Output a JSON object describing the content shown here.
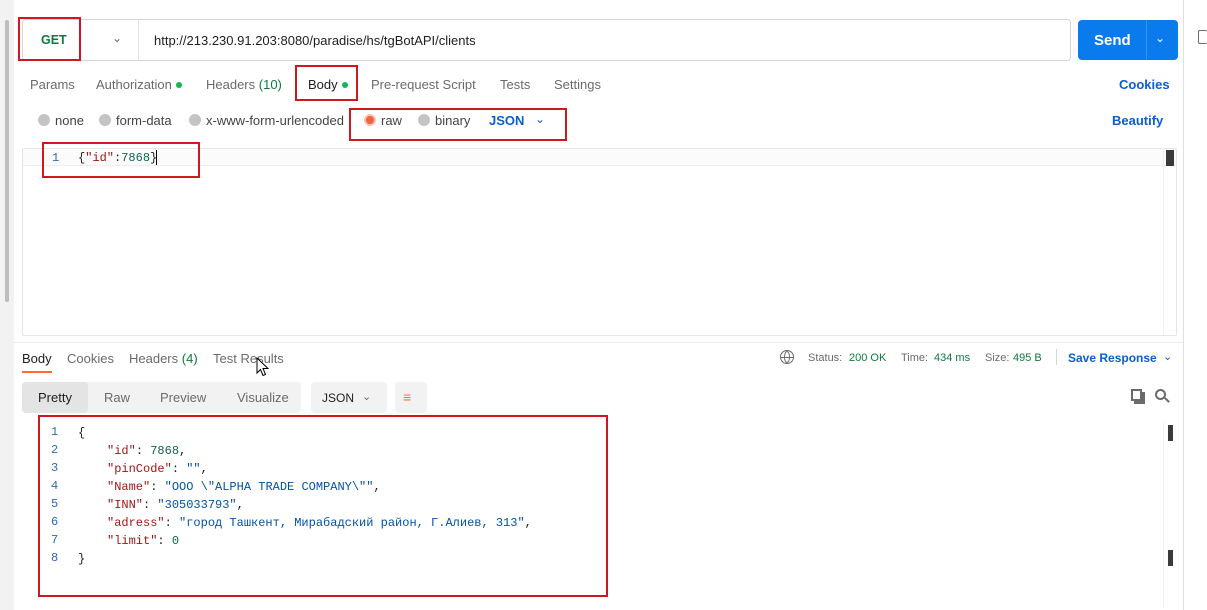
{
  "request": {
    "method": "GET",
    "url": "http://213.230.91.203:8080/paradise/hs/tgBotAPI/clients",
    "send_label": "Send"
  },
  "request_tabs": {
    "params": "Params",
    "authorization": "Authorization",
    "headers": "Headers",
    "headers_count": "(10)",
    "body": "Body",
    "pre_request": "Pre-request Script",
    "tests": "Tests",
    "settings": "Settings",
    "cookies": "Cookies"
  },
  "body_types": {
    "none": "none",
    "form_data": "form-data",
    "urlencoded": "x-www-form-urlencoded",
    "raw": "raw",
    "binary": "binary",
    "selected": "raw",
    "format": "JSON",
    "beautify": "Beautify"
  },
  "request_body": {
    "line_number": "1",
    "open": "{",
    "key": "\"id\"",
    "colon": ":",
    "value": "7868",
    "close": "}"
  },
  "response_tabs": {
    "body": "Body",
    "cookies": "Cookies",
    "headers": "Headers",
    "headers_count": "(4)",
    "test_results": "Test Results"
  },
  "response_meta": {
    "status_label": "Status:",
    "status_value": "200 OK",
    "time_label": "Time:",
    "time_value": "434 ms",
    "size_label": "Size:",
    "size_value": "495 B",
    "save_response": "Save Response"
  },
  "response_view": {
    "pretty": "Pretty",
    "raw": "Raw",
    "preview": "Preview",
    "visualize": "Visualize",
    "format": "JSON"
  },
  "response_body": {
    "line_numbers": [
      "1",
      "2",
      "3",
      "4",
      "5",
      "6",
      "7",
      "8"
    ],
    "open": "{",
    "close": "}",
    "fields": [
      {
        "key": "\"id\"",
        "value": "7868",
        "type": "number",
        "comma": ","
      },
      {
        "key": "\"pinCode\"",
        "value": "\"\"",
        "type": "string",
        "comma": ","
      },
      {
        "key": "\"Name\"",
        "value": "\"ООО \\\"ALPHA TRADE COMPANY\\\"\"",
        "type": "string",
        "comma": ","
      },
      {
        "key": "\"INN\"",
        "value": "\"305033793\"",
        "type": "string",
        "comma": ","
      },
      {
        "key": "\"adress\"",
        "value": "\"город Ташкент, Мирабадский район, Г.Алиев, 313\"",
        "type": "string",
        "comma": ","
      },
      {
        "key": "\"limit\"",
        "value": "0",
        "type": "number",
        "comma": ""
      }
    ]
  },
  "colors": {
    "accent": "#097bed",
    "method_green": "#0c7a3e",
    "highlight_box": "#d0161f",
    "status_green": "#0c7a3e",
    "link_blue": "#0b5ecf",
    "tab_underline": "#ff6c37"
  }
}
